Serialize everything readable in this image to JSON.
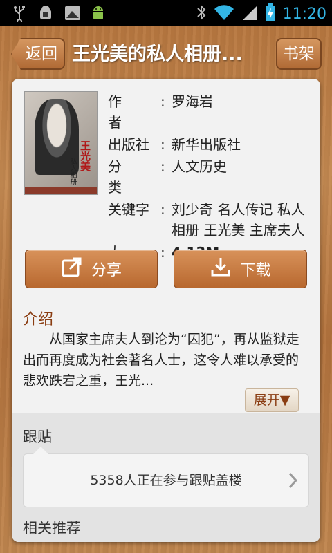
{
  "status_bar": {
    "time": "11:20",
    "icons": [
      "usb-icon",
      "android-debug-icon",
      "image-icon",
      "android-icon",
      "bluetooth-icon",
      "wifi-icon",
      "signal-icon",
      "battery-icon"
    ]
  },
  "header": {
    "back_label": "返回",
    "title": "王光美的私人相册...",
    "shelf_label": "书架"
  },
  "book": {
    "cover": {
      "title_glyphs": "王光美",
      "subtitle": "私人相册"
    },
    "fields": [
      {
        "label": "作者",
        "value": "罗海岩"
      },
      {
        "label": "出版社",
        "value": "新华出版社"
      },
      {
        "label": "分类",
        "value": "人文历史"
      },
      {
        "label": "关键字",
        "value": "刘少奇 名人传记 私人相册 王光美 主席夫人"
      },
      {
        "label": "大小",
        "value": "4.13M"
      }
    ]
  },
  "actions": {
    "share_label": "分享",
    "download_label": "下载"
  },
  "intro": {
    "heading": "介绍",
    "text": "从国家主席夫人到沦为“囚犯”，再从监狱走出而再度成为社会著名人士，这令人难以承受的悲欢跌宕之重，王光...",
    "expand_label": "展开▼"
  },
  "follow": {
    "heading": "跟贴",
    "summary": "5358人正在参与跟贴盖楼"
  },
  "related": {
    "heading": "相关推荐"
  },
  "colors": {
    "accent_brown": "#b8682f",
    "heading_brown": "#8a3d12",
    "clock_blue": "#33b5e5"
  }
}
